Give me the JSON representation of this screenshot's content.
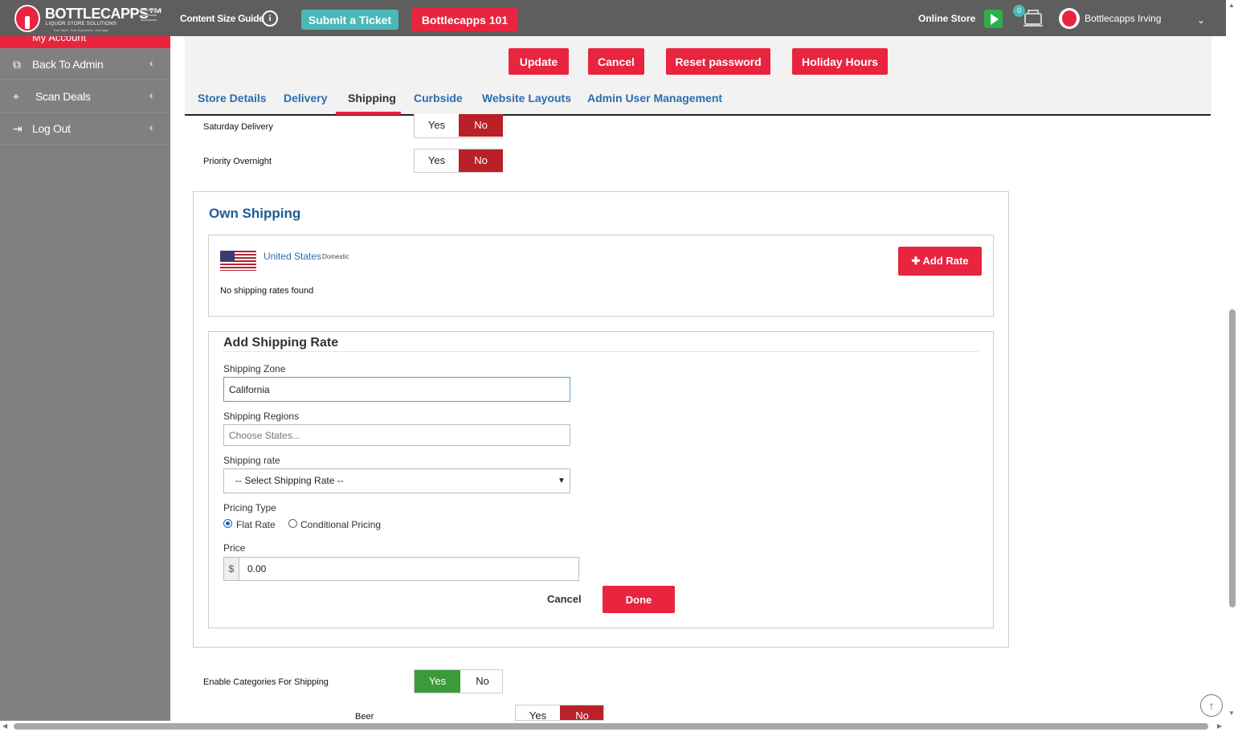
{
  "header": {
    "brand": "BOTTLECAPPS™",
    "tagline": "LIQUOR STORE SOLUTIONS",
    "subtagline": "Your Store. Your Customers. Your App.",
    "content_guide": "Content Size Guide",
    "submit_ticket": "Submit a Ticket",
    "bottlecapps_101": "Bottlecapps 101",
    "online_store": "Online Store",
    "notification_count": "0",
    "user_name": "Bottlecapps Irving"
  },
  "sidebar": {
    "my_account": "My Account",
    "items": [
      {
        "label": "Back To Admin",
        "icon": "admin-icon"
      },
      {
        "label": "Scan Deals",
        "icon": "tag-icon"
      },
      {
        "label": "Log Out",
        "icon": "logout-icon"
      }
    ]
  },
  "actions": {
    "update": "Update",
    "cancel": "Cancel",
    "reset_password": "Reset password",
    "holiday_hours": "Holiday Hours"
  },
  "tabs": [
    {
      "label": "Store Details"
    },
    {
      "label": "Delivery"
    },
    {
      "label": "Shipping",
      "active": true
    },
    {
      "label": "Curbside"
    },
    {
      "label": "Website Layouts"
    },
    {
      "label": "Admin User Management"
    }
  ],
  "options": {
    "saturday_delivery": {
      "label": "Saturday Delivery",
      "yes": "Yes",
      "no": "No",
      "value": "No"
    },
    "priority_overnight": {
      "label": "Priority Overnight",
      "yes": "Yes",
      "no": "No",
      "value": "No"
    },
    "enable_categories": {
      "label": "Enable Categories For Shipping",
      "yes": "Yes",
      "no": "No",
      "value": "Yes"
    },
    "beer": {
      "label": "Beer",
      "yes": "Yes",
      "no": "No",
      "value": "No"
    }
  },
  "own_shipping": {
    "title": "Own Shipping",
    "country": "United States",
    "scope": "Domestic",
    "no_rates": "No shipping rates found",
    "add_rate": "Add Rate"
  },
  "form": {
    "title": "Add Shipping Rate",
    "zone_label": "Shipping Zone",
    "zone_value": "California",
    "regions_label": "Shipping Regions",
    "regions_placeholder": "Choose States...",
    "rate_label": "Shipping rate",
    "rate_selected": "-- Select Shipping Rate --",
    "pricing_label": "Pricing Type",
    "pricing_flat": "Flat Rate",
    "pricing_conditional": "Conditional Pricing",
    "pricing_selected": "Flat Rate",
    "price_label": "Price",
    "currency": "$",
    "price_value": "0.00",
    "cancel": "Cancel",
    "done": "Done"
  },
  "colors": {
    "accent": "#e8243f",
    "teal": "#4bb8b8",
    "link": "#2a6db0",
    "toggle_no": "#b82127",
    "toggle_yes": "#3b9b3b",
    "topbar": "#5e5e5e",
    "sidebar": "#808080"
  }
}
